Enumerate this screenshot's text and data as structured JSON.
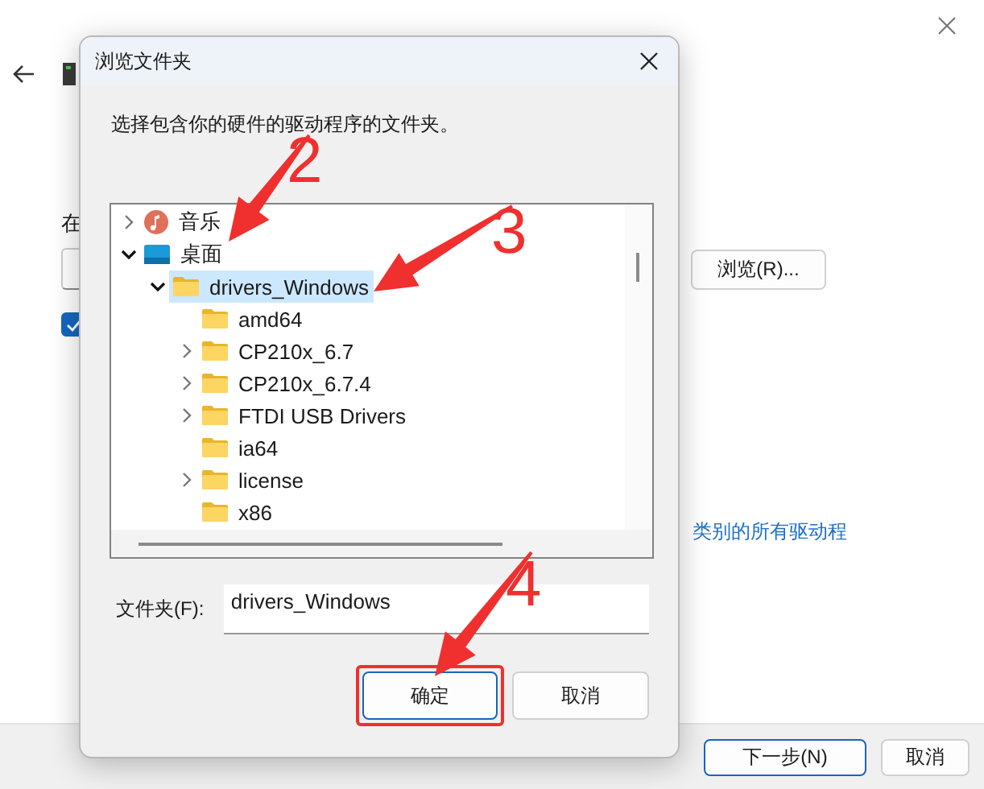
{
  "background_window": {
    "label": "在",
    "browse_button": "浏览(R)...",
    "include_subfolders": {
      "checked": true
    },
    "link": "类别的所有驱动程",
    "next_button": "下一步(N)",
    "cancel_button": "取消"
  },
  "dialog": {
    "title": "浏览文件夹",
    "instruction": "选择包含你的硬件的驱动程序的文件夹。",
    "tree": [
      {
        "label": "音乐",
        "kind": "music",
        "expanded": false,
        "selected": false
      },
      {
        "label": "桌面",
        "kind": "desktop",
        "expanded": true,
        "selected": false,
        "children": [
          {
            "label": "drivers_Windows",
            "kind": "folder",
            "expanded": true,
            "selected": true,
            "children": [
              {
                "label": "amd64",
                "kind": "folder",
                "selected": false
              },
              {
                "label": "CP210x_6.7",
                "kind": "folder",
                "expanded": false,
                "selected": false
              },
              {
                "label": "CP210x_6.7.4",
                "kind": "folder",
                "expanded": false,
                "selected": false
              },
              {
                "label": "FTDI USB Drivers",
                "kind": "folder",
                "expanded": false,
                "selected": false
              },
              {
                "label": "ia64",
                "kind": "folder",
                "selected": false
              },
              {
                "label": "license",
                "kind": "folder",
                "expanded": false,
                "selected": false
              },
              {
                "label": "x86",
                "kind": "folder",
                "selected": false
              }
            ]
          }
        ]
      }
    ],
    "folder_label": "文件夹(F):",
    "folder_field": {
      "value": "drivers_Windows"
    },
    "ok_button": {
      "label": "确定",
      "highlighted": true
    },
    "cancel_button": "取消"
  },
  "annotations": [
    {
      "label": "2"
    },
    {
      "label": "3"
    },
    {
      "label": "4"
    }
  ]
}
